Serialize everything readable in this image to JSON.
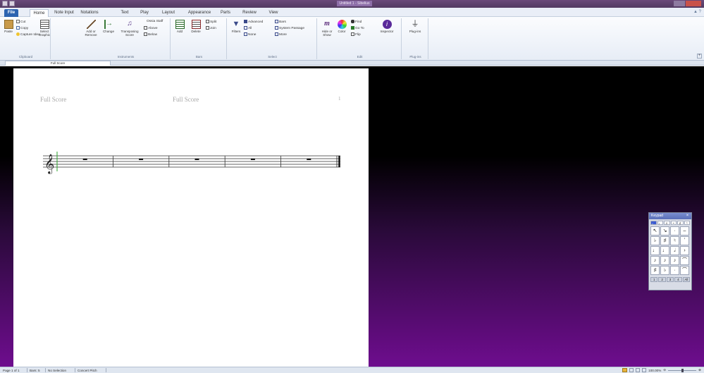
{
  "window": {
    "title": "Untitled 1 - Sibelius"
  },
  "ribbon_tabs": [
    "File",
    "Home",
    "Note Input",
    "Notations",
    "Text",
    "Play",
    "Layout",
    "Appearance",
    "Parts",
    "Review",
    "View"
  ],
  "clipboard": {
    "paste": "Paste",
    "cut": "Cut",
    "copy": "Copy",
    "capture_idea": "Capture Idea",
    "select_graphic": "Select Graphic",
    "label": "Clipboard"
  },
  "instruments": {
    "add_remove": "Add or Remove",
    "change": "Change",
    "transposing_score": "Transposing Score",
    "ossia_staff": "Ossia Staff",
    "above": "Above",
    "below": "Below",
    "label": "Instruments"
  },
  "bars": {
    "add": "Add",
    "delete": "Delete",
    "split": "Split",
    "join": "Join",
    "label": "Bars"
  },
  "select": {
    "filters": "Filters",
    "advanced": "Advanced",
    "all": "All",
    "none": "None",
    "bars": "Bars",
    "system_passage": "System Passage",
    "more": "More",
    "label": "Select"
  },
  "edit": {
    "hide_show": "Hide or Show",
    "color": "Color",
    "find": "Find",
    "go_to": "Go To",
    "flip": "Flip",
    "inspector": "Inspector",
    "label": "Edit"
  },
  "plugins": {
    "plugins": "Plug-ins",
    "label": "Plug-ins"
  },
  "document_tab": "Full Score",
  "score": {
    "header_left": "Full Score",
    "header_center": "Full Score",
    "page_number": "1",
    "bars": 5
  },
  "keypad": {
    "title": "Keypad",
    "close": "×",
    "tabs": [
      "♩",
      "♩",
      "♬",
      "𝄐",
      "♯",
      "♮"
    ],
    "keys": [
      "↖",
      "↘",
      "·",
      "–",
      "♭",
      "♯",
      "♮",
      "ʼ",
      "♩",
      "♩",
      "𝅗𝅥",
      "›",
      "♪",
      "♪",
      "♪",
      "⌒",
      "♯",
      "♭",
      "·",
      "⌒"
    ],
    "layouts": [
      "1",
      "2",
      "3",
      "4",
      "All"
    ]
  },
  "status": {
    "page": "Page 1 of 1",
    "bars": "Bars: 5",
    "selection": "No Selection",
    "pitch": "Concert Pitch",
    "zoom": "100.00%"
  },
  "colors": {
    "file_tab": "#2c63b0",
    "workspace_top": "#000000",
    "workspace_bottom": "#6e0d8e"
  }
}
